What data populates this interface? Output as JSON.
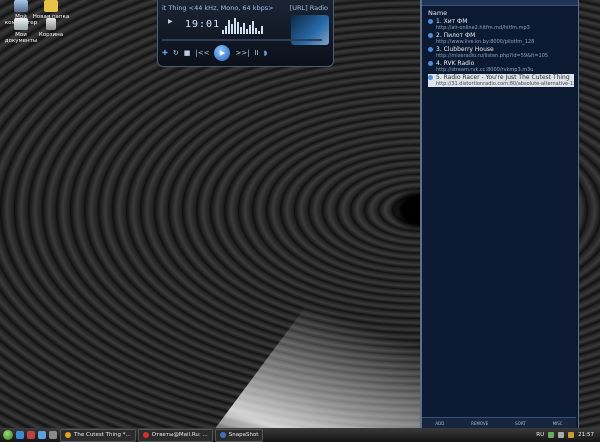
{
  "desktop": {
    "icons": [
      {
        "label": "Мой компьютер",
        "icon": "my-computer-icon"
      },
      {
        "label": "Новая папка",
        "icon": "folder-icon"
      },
      {
        "label": "Мои документы",
        "icon": "my-documents-icon"
      },
      {
        "label": "Корзина",
        "icon": "recycle-bin-icon"
      }
    ]
  },
  "player": {
    "title_left": "it Thing <44 kHz, Mono, 64 kbps>",
    "title_right": "[URL] Radio",
    "time": "19:01",
    "buttons": {
      "prev": "|<<",
      "next": ">>|",
      "play": "▶",
      "pause": "II"
    }
  },
  "playlist": {
    "header": "Name",
    "items": [
      {
        "name": "1. Хит ФМ",
        "url": "http://air-online2.hitfm.md/hitfm.mp3"
      },
      {
        "name": "2. Пилот ФМ",
        "url": "http://www.live.kn.by:8000/pilotfm_128"
      },
      {
        "name": "3. Clubberry House",
        "url": "http://mixeradio.ru/listen.php?id=59&lt=105"
      },
      {
        "name": "4. RVK Radio",
        "url": "http://stream.rvk.cc:8000/rvkmp3.m3u"
      },
      {
        "name": "5. Radio Racer - You're Just The Cutest Thing",
        "url": "http://31.distortionradio.com:80/absolute-alternative-128"
      }
    ],
    "footer": [
      "ADD",
      "REMOVE",
      "SORT",
      "MISC"
    ]
  },
  "taskbar": {
    "tasks": [
      {
        "label": "The Cutest Thing *...",
        "color": "#e0a020"
      },
      {
        "label": "Ответы@Mail.Ru: ...",
        "color": "#d03030"
      },
      {
        "label": "SnapaShot",
        "color": "#4070c0"
      }
    ],
    "lang": "RU",
    "clock": "21:57"
  }
}
